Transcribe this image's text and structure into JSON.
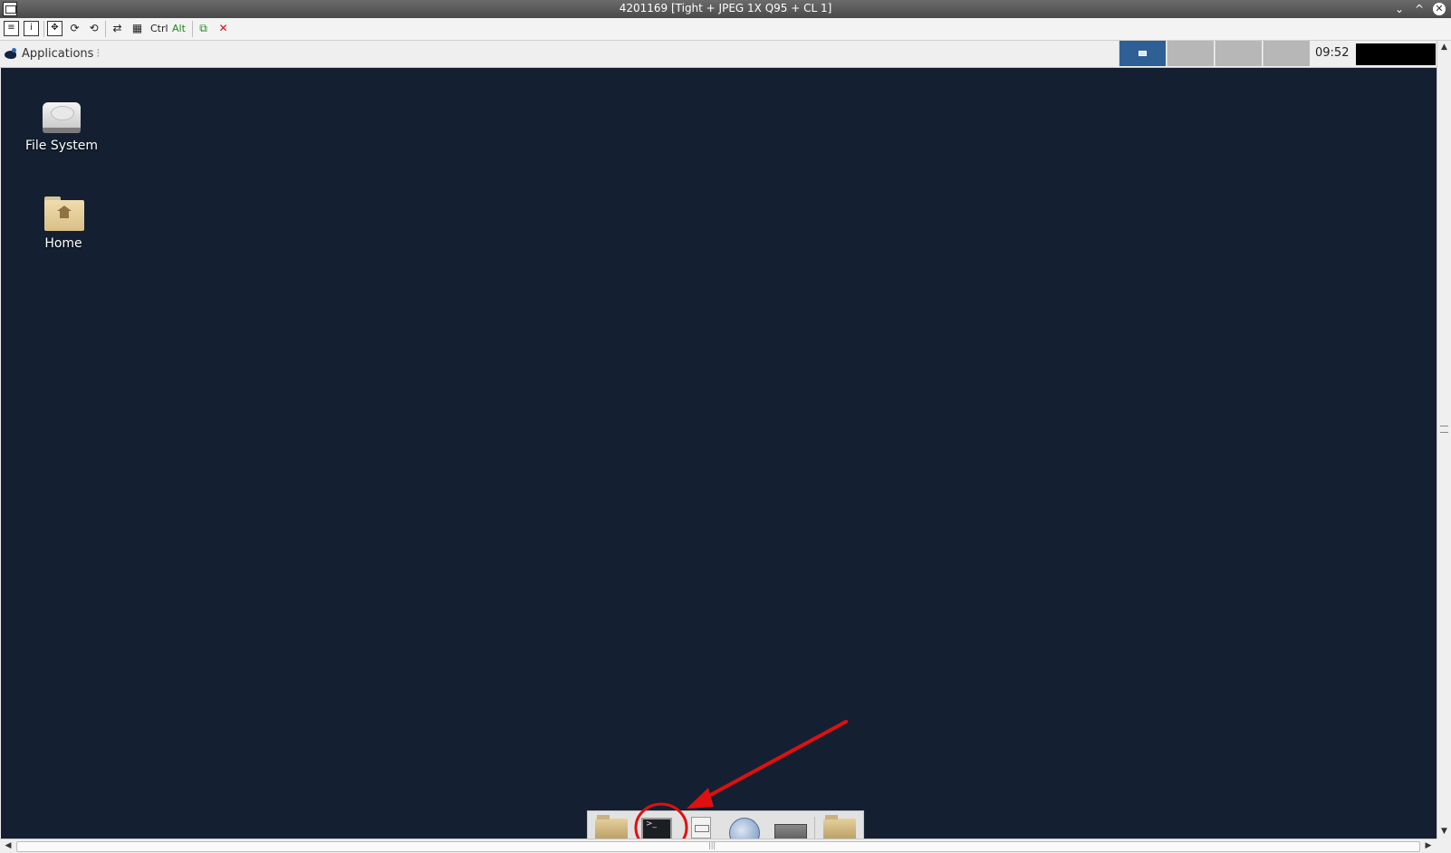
{
  "window": {
    "title": "4201169 [Tight + JPEG 1X Q95 + CL 1]",
    "minimize": "⌄",
    "maximize": "^",
    "close": "✕"
  },
  "vnc_toolbar": {
    "ctrl_label": "Ctrl",
    "alt_label": "Alt",
    "icons": [
      "options-icon",
      "info-icon",
      "fullscreen-icon",
      "refresh-icon",
      "refresh-full-icon",
      "transfer-icon",
      "file-transfer-icon",
      "ctrl-key-button",
      "alt-key-button",
      "clipboard-icon",
      "disconnect-icon"
    ]
  },
  "panel": {
    "applications_label": "Applications",
    "clock": "09:52",
    "workspaces": [
      {
        "active": true
      },
      {
        "active": false
      },
      {
        "active": false
      },
      {
        "active": false
      }
    ]
  },
  "desktop": {
    "background_color": "#142032",
    "icons": [
      {
        "label": "File System",
        "icon": "hard-disk-icon"
      },
      {
        "label": "Home",
        "icon": "home-folder-icon"
      }
    ]
  },
  "dock": {
    "items": [
      "folder-icon",
      "terminal-icon",
      "app-finder-icon",
      "web-browser-icon",
      "screen-icon",
      "files-icon"
    ]
  },
  "annotation": {
    "color": "#e01010",
    "target": "terminal-icon"
  }
}
